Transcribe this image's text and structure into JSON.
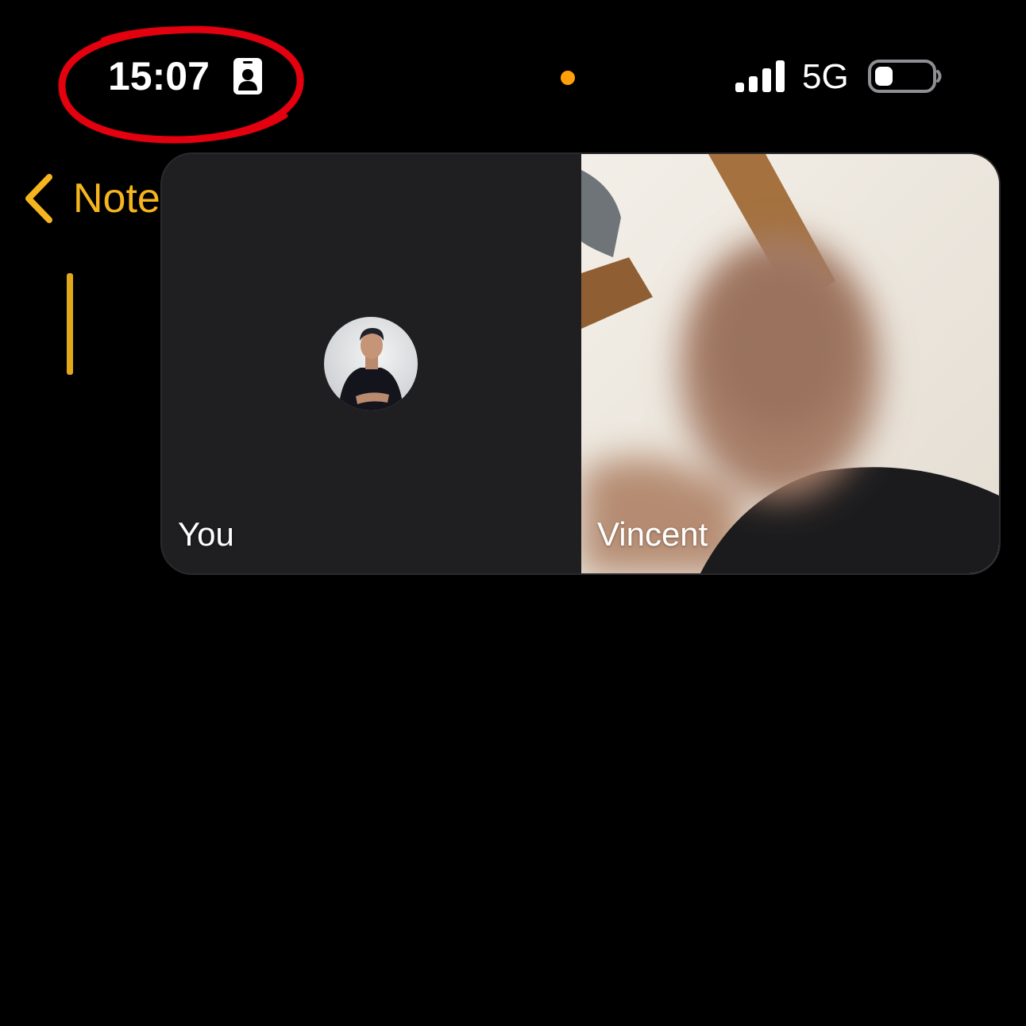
{
  "status_bar": {
    "time": "15:07",
    "network": "5G",
    "signal_bars": 4,
    "battery_level": 0.2,
    "privacy_indicator_color": "#ff9f0a",
    "icons": [
      "contact-card-icon",
      "signal-icon",
      "battery-icon"
    ]
  },
  "notes_nav": {
    "back_label": "Note",
    "accent_color": "#f5b51e"
  },
  "call": {
    "participants": [
      {
        "label": "You",
        "video": false,
        "avatar": "user-avatar"
      },
      {
        "label": "Vincent",
        "video": true
      }
    ]
  },
  "annotation": {
    "color": "#e3000f",
    "shape": "circle-around-time"
  }
}
